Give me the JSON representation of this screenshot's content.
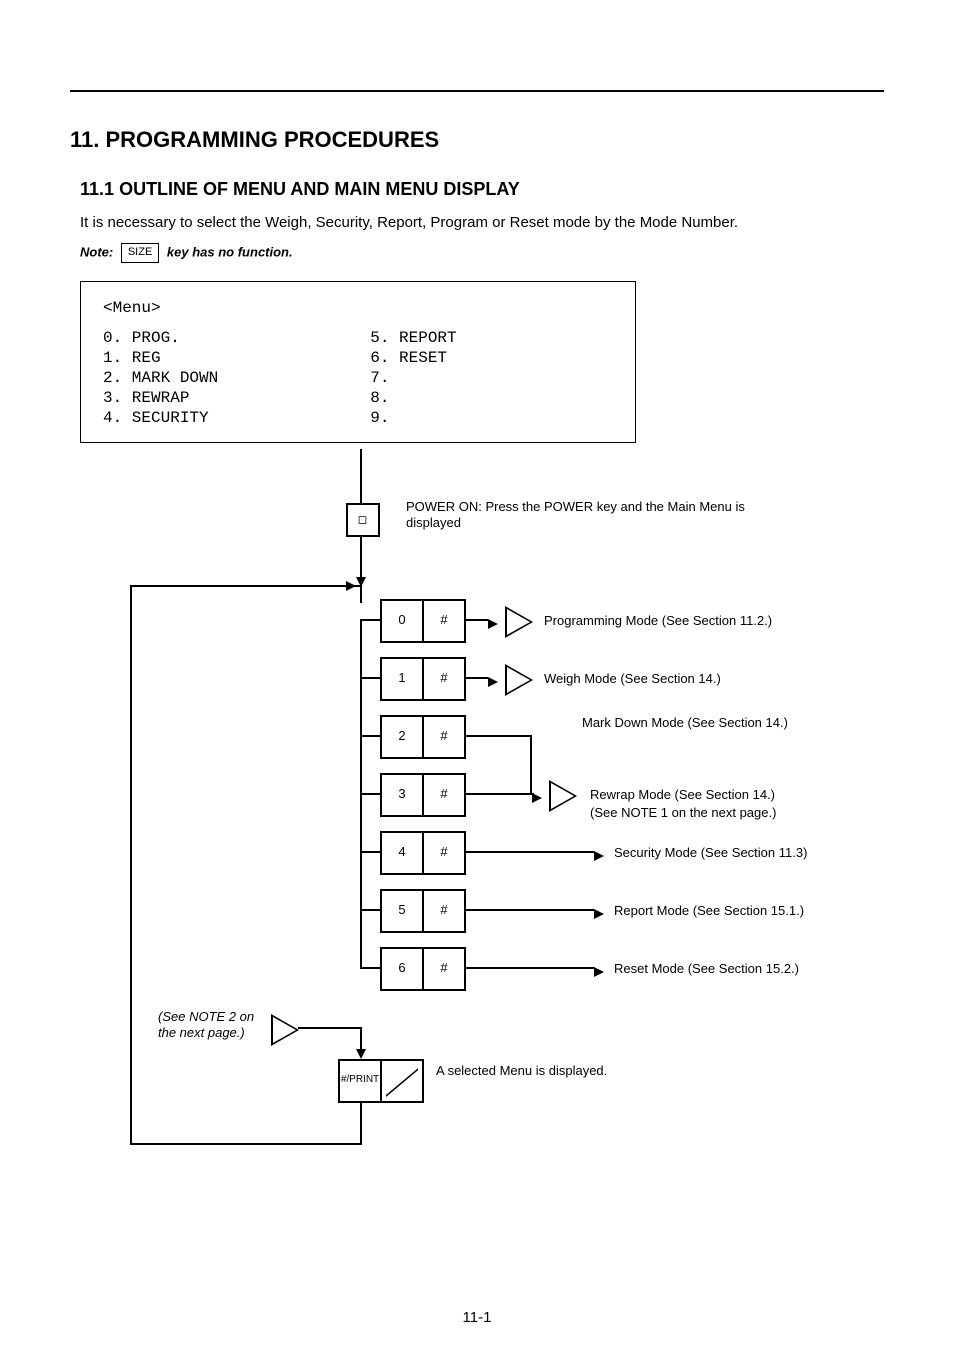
{
  "chapter": {
    "no": "11.",
    "title": "PROGRAMMING PROCEDURES"
  },
  "subsection": {
    "no": "11.1",
    "title": "OUTLINE OF MENU AND MAIN MENU DISPLAY"
  },
  "intro": "It is necessary to select the Weigh, Security, Report, Program or Reset mode by the Mode Number.",
  "note_prefix": "Note:",
  "note_body": " key has no function.",
  "keycap_size": "SIZE",
  "menu": {
    "title": "<Menu>",
    "left": [
      "0. PROG.",
      "1. REG",
      "2. MARK DOWN",
      "3. REWRAP",
      "4. SECURITY"
    ],
    "right": [
      "5. REPORT",
      "6. RESET",
      "7.",
      "8.",
      "9."
    ]
  },
  "steps": {
    "power_on": "POWER ON: Press the POWER key and the Main Menu is displayed",
    "s0": {
      "k1": "0",
      "k2": "#",
      "label": "Programming Mode (See Section 11.2.)"
    },
    "s1": {
      "k1": "1",
      "k2": "#",
      "label": "Weigh Mode (See Section 14.)"
    },
    "s2": {
      "k1": "2",
      "k2": "#",
      "label": "Mark Down Mode (See Section 14.)"
    },
    "s3": {
      "k1": "3",
      "k2": "#",
      "label": "Rewrap Mode (See Section 14.)"
    },
    "s4": {
      "k1": "4",
      "k2": "#",
      "label": "Security Mode (See Section 11.3)"
    },
    "s5": {
      "k1": "5",
      "k2": "#",
      "label": "Report Mode (See Section 15.1.)"
    },
    "s6": {
      "k1": "6",
      "k2": "#",
      "label": "Reset Mode (See Section 15.2.)"
    },
    "note": "(See NOTE 1 on the next page.)",
    "prn": {
      "label": "#/PRINT"
    },
    "bottom_note": "A selected Menu is displayed.",
    "note2": "(See NOTE 2 on the next page.)"
  },
  "pagenum": "11-1"
}
